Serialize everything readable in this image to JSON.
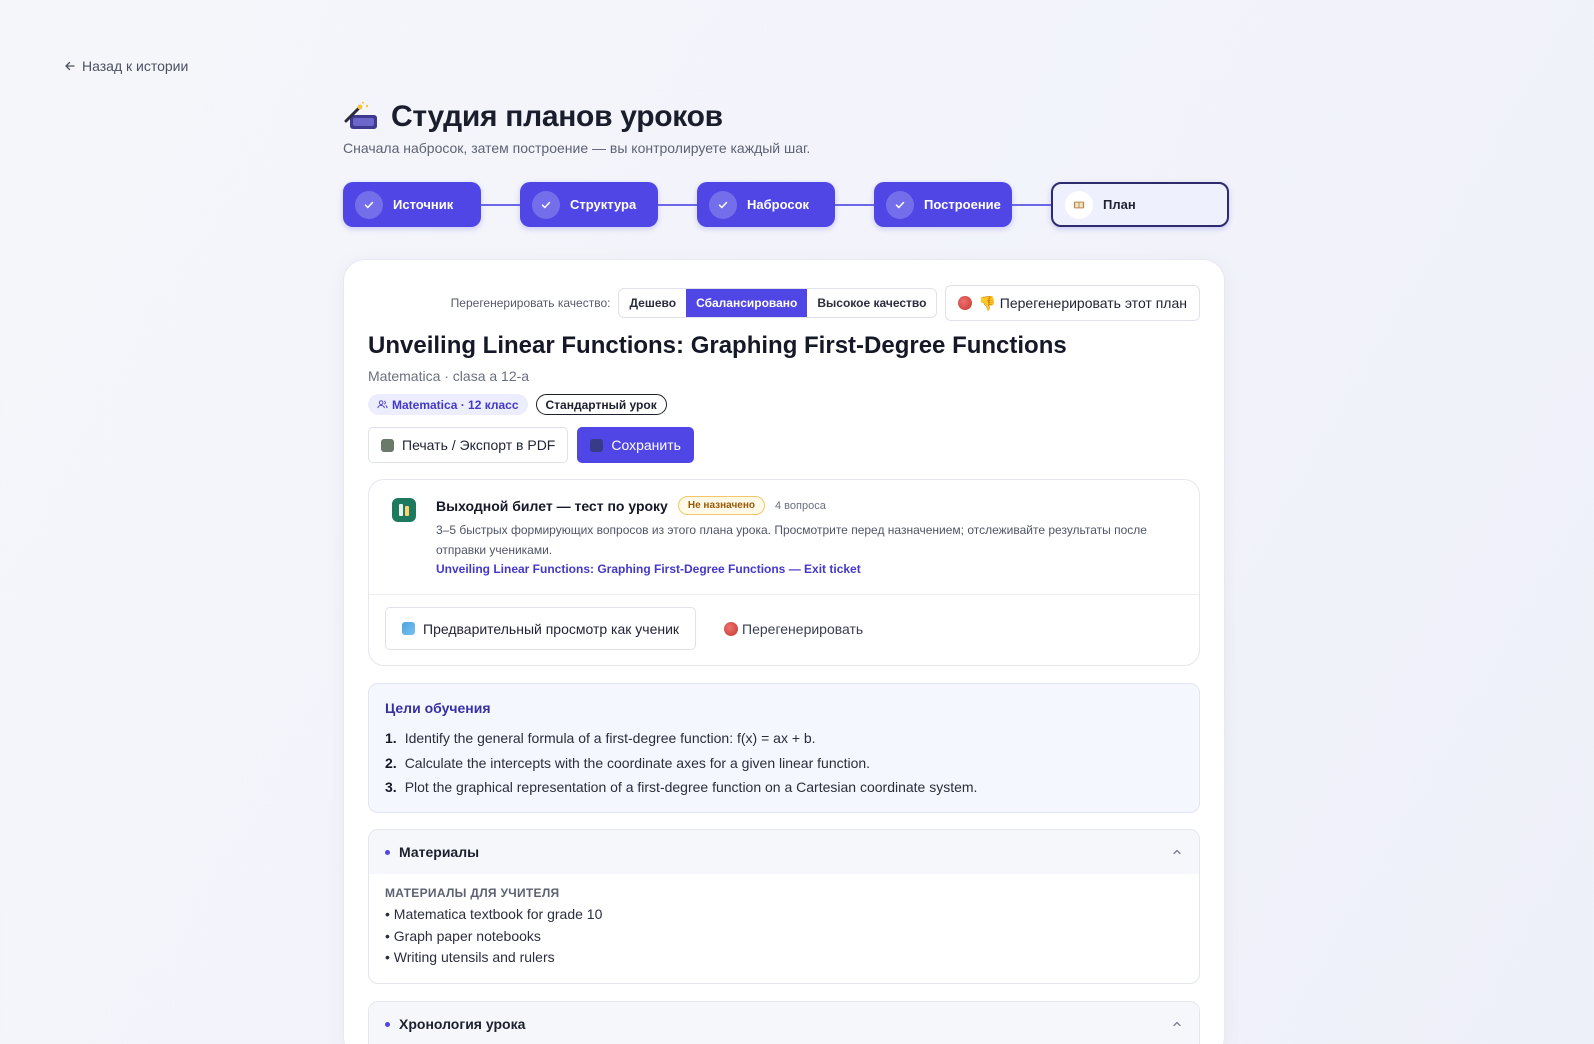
{
  "nav": {
    "back_label": "Назад к истории"
  },
  "header": {
    "title": "Студия планов уроков",
    "subtitle": "Сначала набросок, затем построение — вы контролируете каждый шаг."
  },
  "steps": [
    {
      "label": "Источник",
      "status": "done"
    },
    {
      "label": "Структура",
      "status": "done"
    },
    {
      "label": "Набросок",
      "status": "done"
    },
    {
      "label": "Построение",
      "status": "done"
    },
    {
      "label": "План",
      "status": "current"
    }
  ],
  "regen": {
    "label": "Перегенерировать качество:",
    "options": [
      "Дешево",
      "Сбалансировано",
      "Высокое качество"
    ],
    "selected": "Сбалансировано",
    "button_label": "👎 Перегенерировать этот план"
  },
  "plan": {
    "title": "Unveiling Linear Functions: Graphing First-Degree Functions",
    "subtitle": "Matematica · clasa a 12-a",
    "tags": {
      "subject": "Matematica · 12 класс",
      "type": "Стандартный урок"
    },
    "print_label": "Печать / Экспорт в PDF",
    "save_label": "Сохранить"
  },
  "exit_ticket": {
    "title": "Выходной билет — тест по уроку",
    "status": "Не назначено",
    "count": "4 вопроса",
    "description": "3–5 быстрых формирующих вопросов из этого плана урока. Просмотрите перед назначением; отслеживайте результаты после отправки учениками.",
    "link": "Unveiling Linear Functions: Graphing First-Degree Functions — Exit ticket",
    "preview_label": "Предварительный просмотр как ученик",
    "regen_label": "Перегенерировать"
  },
  "goals": {
    "heading": "Цели обучения",
    "items": [
      {
        "num": "1.",
        "text": "Identify the general formula of a first-degree function: f(x) = ax + b."
      },
      {
        "num": "2.",
        "text": "Calculate the intercepts with the coordinate axes for a given linear function."
      },
      {
        "num": "3.",
        "text": "Plot the graphical representation of a first-degree function on a Cartesian coordinate system."
      }
    ]
  },
  "materials": {
    "label": "Материалы",
    "heading": "МАТЕРИАЛЫ ДЛЯ УЧИТЕЛЯ",
    "items": [
      "• Matematica textbook for grade 10",
      "• Graph paper notebooks",
      "• Writing utensils and rulers"
    ]
  },
  "timeline": {
    "label": "Хронология урока"
  },
  "colors": {
    "accent": "#4f46e5",
    "accent_text": "#4338ca",
    "warning": "#f2c766"
  }
}
